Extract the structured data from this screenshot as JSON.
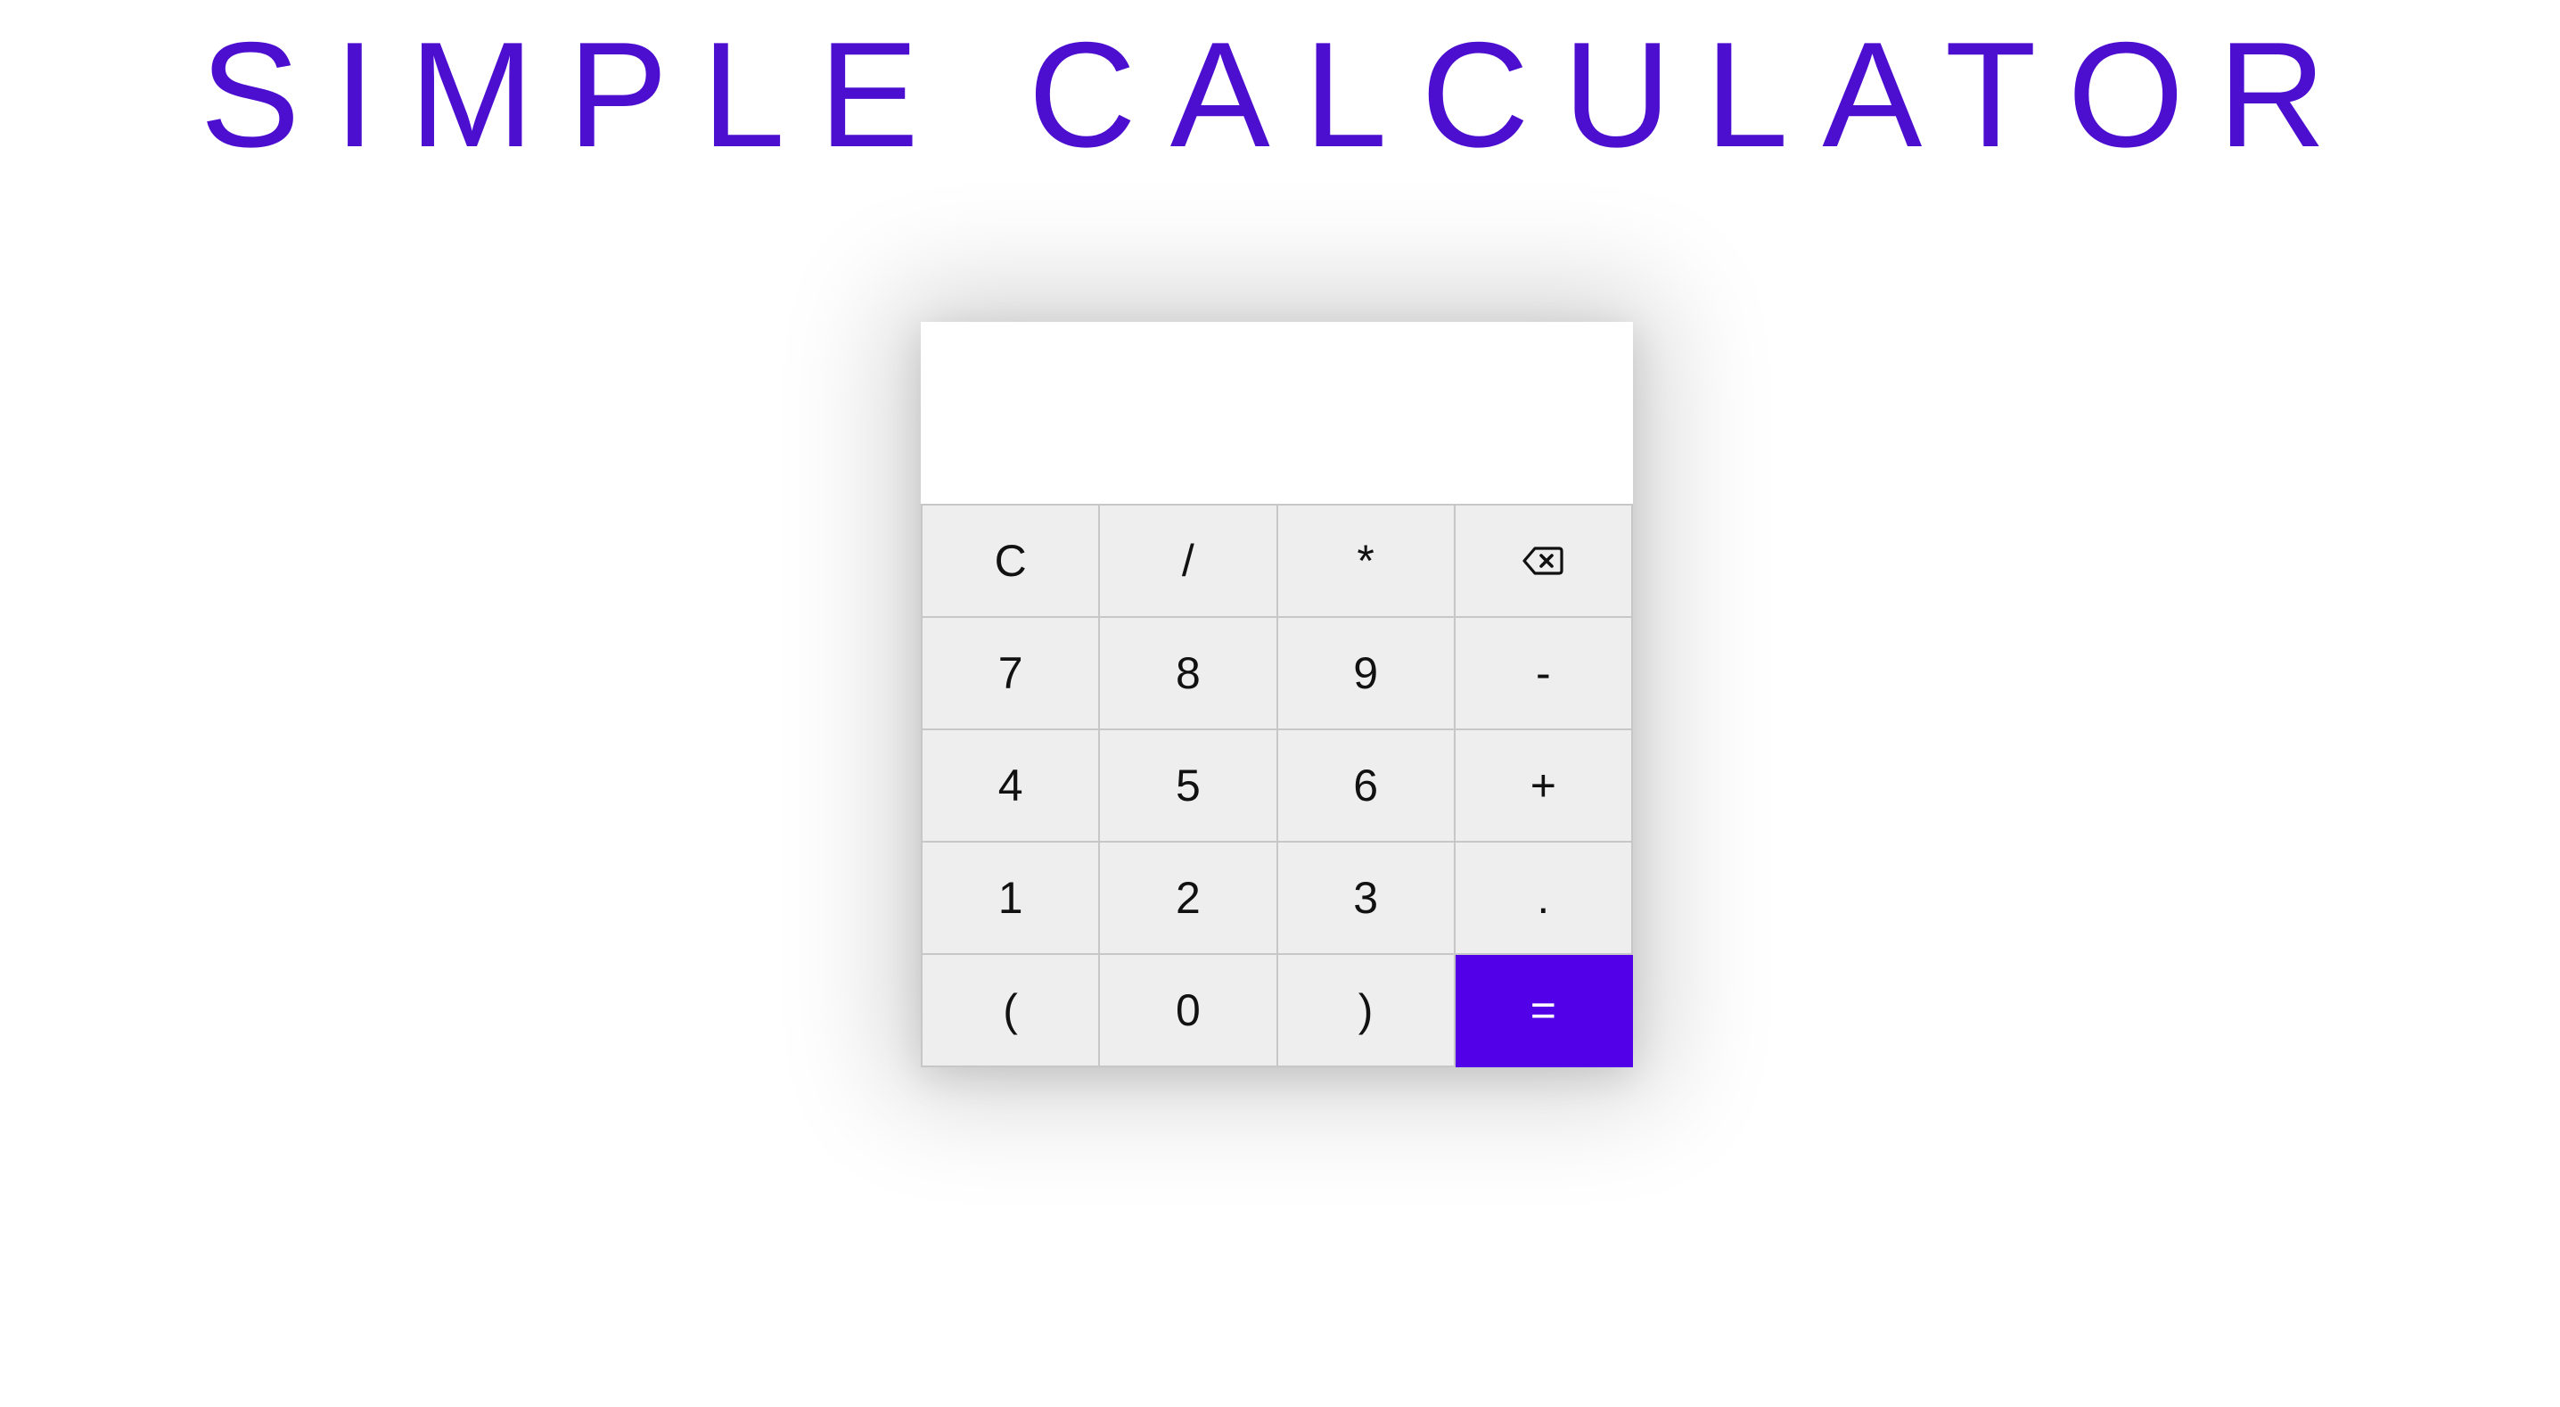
{
  "title": {
    "text": "SIMPLE CALCULATOR"
  },
  "display": {
    "value": "",
    "placeholder": ""
  },
  "colors": {
    "title": "#4c0fd0",
    "equals_bg": "#5200e8",
    "key_bg": "#eeeeee",
    "key_border": "#c7c7c7"
  },
  "keys": [
    {
      "label": "C",
      "name": "clear-button"
    },
    {
      "label": "/",
      "name": "divide-button"
    },
    {
      "label": "*",
      "name": "multiply-button"
    },
    {
      "label": "",
      "name": "backspace-button",
      "icon": "backspace-icon"
    },
    {
      "label": "7",
      "name": "digit-7-button"
    },
    {
      "label": "8",
      "name": "digit-8-button"
    },
    {
      "label": "9",
      "name": "digit-9-button"
    },
    {
      "label": "-",
      "name": "subtract-button"
    },
    {
      "label": "4",
      "name": "digit-4-button"
    },
    {
      "label": "5",
      "name": "digit-5-button"
    },
    {
      "label": "6",
      "name": "digit-6-button"
    },
    {
      "label": "+",
      "name": "add-button"
    },
    {
      "label": "1",
      "name": "digit-1-button"
    },
    {
      "label": "2",
      "name": "digit-2-button"
    },
    {
      "label": "3",
      "name": "digit-3-button"
    },
    {
      "label": ".",
      "name": "decimal-button"
    },
    {
      "label": "(",
      "name": "open-paren-button"
    },
    {
      "label": "0",
      "name": "digit-0-button"
    },
    {
      "label": ")",
      "name": "close-paren-button"
    },
    {
      "label": "=",
      "name": "equals-button"
    }
  ]
}
